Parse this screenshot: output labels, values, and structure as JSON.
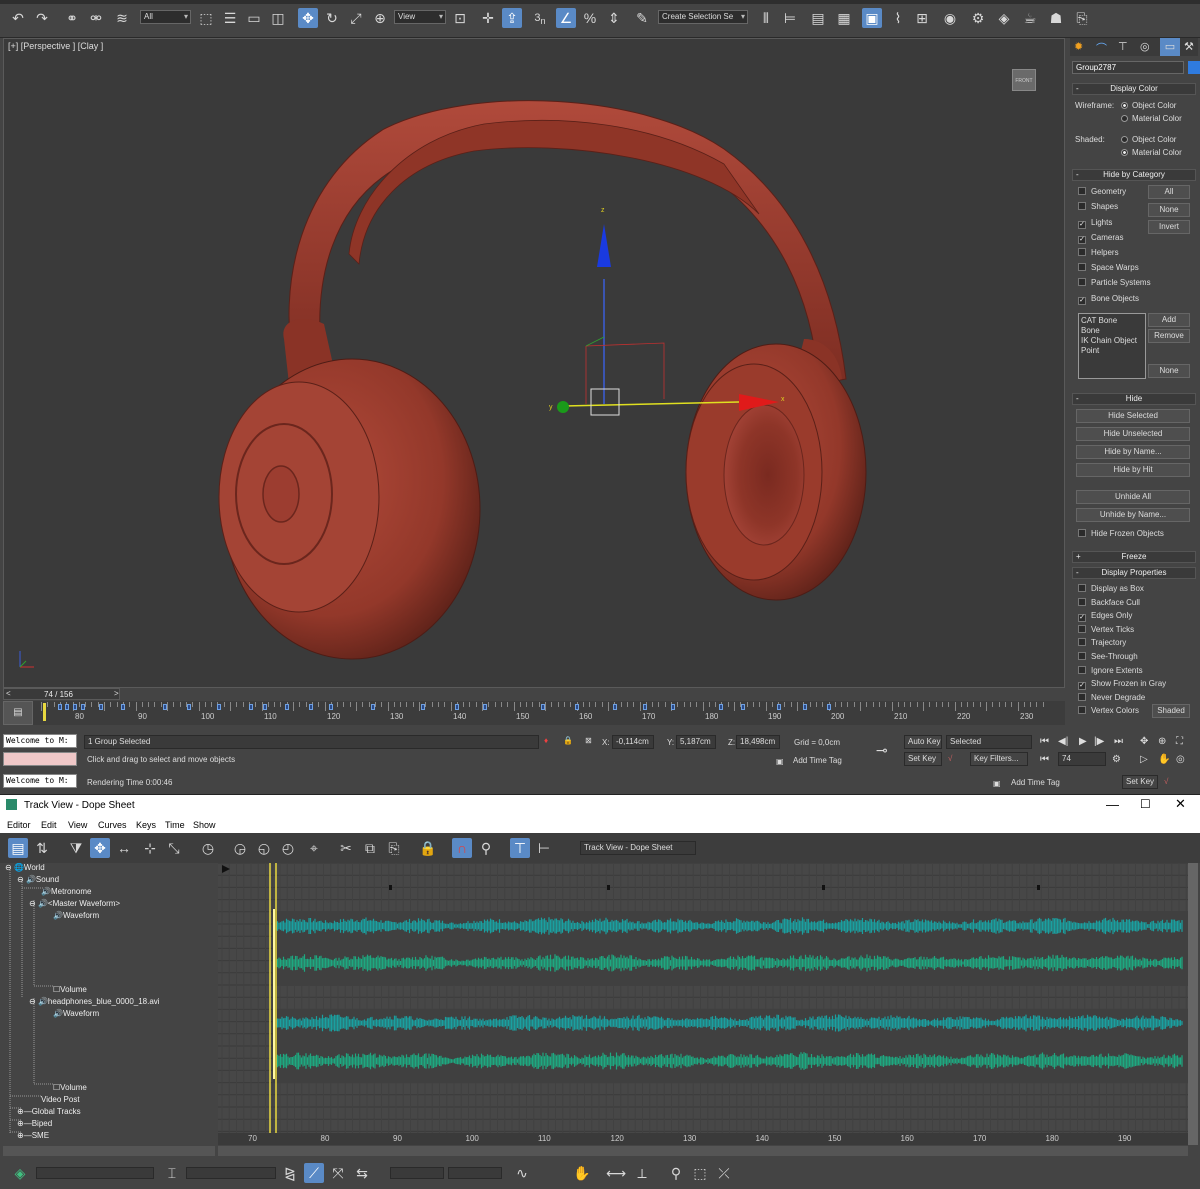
{
  "toolbar": {
    "selection_filter": "All",
    "reference_coord": "View",
    "named_selection": "Create Selection Se",
    "snap_3": "3"
  },
  "viewport": {
    "label": "[+] [Perspective ] [Clay ]",
    "viewcube_text": "FRONT",
    "gizmo_x_label": "x",
    "gizmo_y_label": "y",
    "gizmo_z_label": "z"
  },
  "timeline": {
    "slider_label": "74 / 156",
    "ticks": [
      "80",
      "90",
      "100",
      "110",
      "120",
      "130",
      "140",
      "150",
      "160",
      "170",
      "180",
      "190",
      "200",
      "210",
      "220",
      "230"
    ]
  },
  "status": {
    "welcome_1": "Welcome to M:",
    "welcome_2": "Welcome to M:",
    "selection_status": "1 Group Selected",
    "prompt": "Click and drag to select and move objects",
    "rendering_time": "Rendering Time  0:00:46",
    "x_label": "X:",
    "x_value": "-0,114cm",
    "y_label": "Y:",
    "y_value": "5,187cm",
    "z_label": "Z:",
    "z_value": "18,498cm",
    "grid": "Grid = 0,0cm",
    "add_time_tag": "Add Time Tag",
    "add_time_tag_2": "Add Time Tag",
    "auto_key": "Auto Key",
    "set_key": "Set Key",
    "set_key_2": "Set Key",
    "key_mode": "Selected",
    "key_filters": "Key Filters...",
    "current_frame": "74"
  },
  "command_panel": {
    "object_name": "Group2787",
    "display_color": {
      "title": "Display Color",
      "wireframe_label": "Wireframe:",
      "shaded_label": "Shaded:",
      "object_color": "Object Color",
      "material_color": "Material Color"
    },
    "hide_by_category": {
      "title": "Hide by Category",
      "items": [
        {
          "label": "Geometry",
          "checked": false
        },
        {
          "label": "Shapes",
          "checked": false
        },
        {
          "label": "Lights",
          "checked": true
        },
        {
          "label": "Cameras",
          "checked": true
        },
        {
          "label": "Helpers",
          "checked": false
        },
        {
          "label": "Space Warps",
          "checked": false
        },
        {
          "label": "Particle Systems",
          "checked": false
        },
        {
          "label": "Bone Objects",
          "checked": true
        }
      ],
      "btn_all": "All",
      "btn_none": "None",
      "btn_invert": "Invert",
      "list": [
        "CAT Bone",
        "Bone",
        "IK Chain Object",
        "Point"
      ],
      "btn_add": "Add",
      "btn_remove": "Remove",
      "btn_none2": "None"
    },
    "hide": {
      "title": "Hide",
      "buttons": [
        "Hide Selected",
        "Hide Unselected",
        "Hide by Name...",
        "Hide by Hit",
        "Unhide All",
        "Unhide by Name..."
      ],
      "hide_frozen": "Hide Frozen Objects"
    },
    "freeze_title": "Freeze",
    "display_properties": {
      "title": "Display Properties",
      "items": [
        {
          "label": "Display as Box",
          "checked": false
        },
        {
          "label": "Backface Cull",
          "checked": false
        },
        {
          "label": "Edges Only",
          "checked": true
        },
        {
          "label": "Vertex Ticks",
          "checked": false
        },
        {
          "label": "Trajectory",
          "checked": false
        },
        {
          "label": "See-Through",
          "checked": false
        },
        {
          "label": "Ignore Extents",
          "checked": false
        },
        {
          "label": "Show Frozen in Gray",
          "checked": true
        },
        {
          "label": "Never Degrade",
          "checked": false
        },
        {
          "label": "Vertex Colors",
          "checked": false
        }
      ],
      "shaded_btn": "Shaded"
    }
  },
  "trackview": {
    "title": "Track View - Dope Sheet",
    "menu": [
      "Editor",
      "Edit",
      "View",
      "Curves",
      "Keys",
      "Time",
      "Show"
    ],
    "name_field": "Track View - Dope Sheet",
    "tree": {
      "world": "World",
      "sound": "Sound",
      "metronome": "Metronome",
      "master_waveform": "<Master Waveform>",
      "waveform_1": "Waveform",
      "volume_1": "Volume",
      "avi": "headphones_blue_0000_18.avi",
      "waveform_2": "Waveform",
      "volume_2": "Volume",
      "video_post": "Video Post",
      "global_tracks": "Global Tracks",
      "biped": "Biped",
      "sme": "SME"
    },
    "ruler_ticks": [
      "70",
      "80",
      "90",
      "100",
      "110",
      "120",
      "130",
      "140",
      "150",
      "160",
      "170",
      "180",
      "190"
    ],
    "current_frame": "74"
  },
  "colors": {
    "headphone": "#9a3b2c",
    "waveform_teal": "#1aa0a0",
    "waveform_green": "#1ea880",
    "selection_blue": "#2f6bd0",
    "accent_active": "#5a8ac6"
  }
}
